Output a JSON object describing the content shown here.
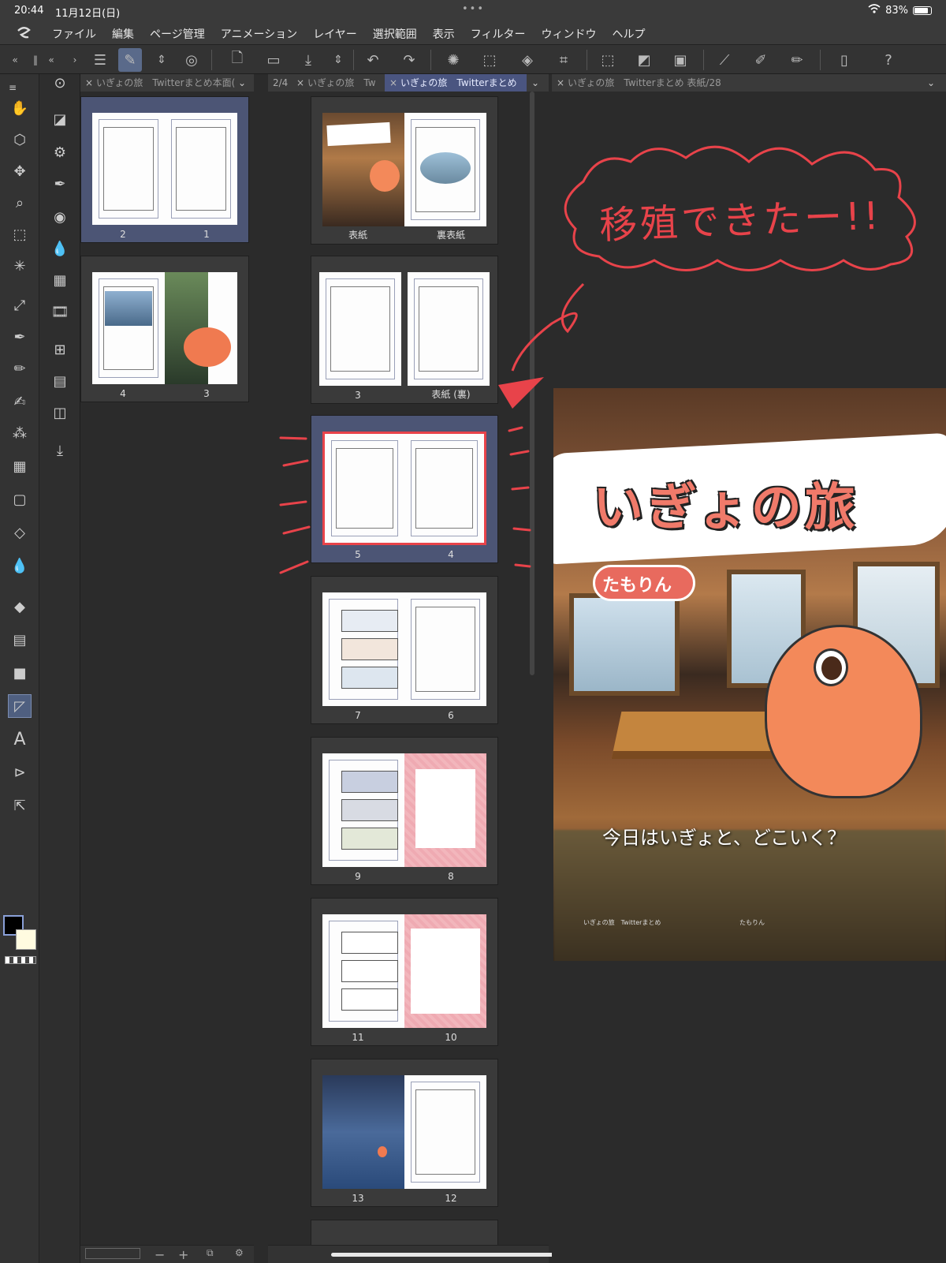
{
  "status": {
    "time": "20:44",
    "date": "11月12日(日)",
    "dots": "•••",
    "battery": "83%"
  },
  "menu": [
    "ファイル",
    "編集",
    "ページ管理",
    "アニメーション",
    "レイヤー",
    "選択範囲",
    "表示",
    "フィルター",
    "ウィンドウ",
    "ヘルプ"
  ],
  "left_panel": {
    "tab_label": "いぎょの旅　Twitterまとめ本面(",
    "spreads": [
      {
        "left": "2",
        "right": "1"
      },
      {
        "left": "4",
        "right": "3"
      }
    ]
  },
  "middle_panel": {
    "counter": "2/4",
    "tab1": "いぎょの旅　Tw",
    "tab2": "いぎょの旅　Twitterまとめ",
    "spreads": [
      {
        "left": "表紙",
        "right": "裏表紙"
      },
      {
        "left": "3",
        "right": "表紙 (裏)"
      },
      {
        "left": "5",
        "right": "4"
      },
      {
        "left": "7",
        "right": "6"
      },
      {
        "left": "9",
        "right": "8"
      },
      {
        "left": "11",
        "right": "10"
      },
      {
        "left": "13",
        "right": "12"
      }
    ]
  },
  "canvas_panel": {
    "tab_label": "いぎょの旅　Twitterまとめ 表紙/28",
    "cover": {
      "title": "いぎょの旅",
      "author": "たもりん",
      "tagline": "今日はいぎょと、どこいく？",
      "footer_left": "いぎょの旅　Twitterまとめ",
      "footer_right": "たもりん"
    }
  },
  "annotation": {
    "text": "移殖できたー!!",
    "color": "#e8434a"
  },
  "colors": {
    "accent": "#4a5580",
    "selected_spread": "#4c5575",
    "annotation_red": "#e8434a"
  }
}
